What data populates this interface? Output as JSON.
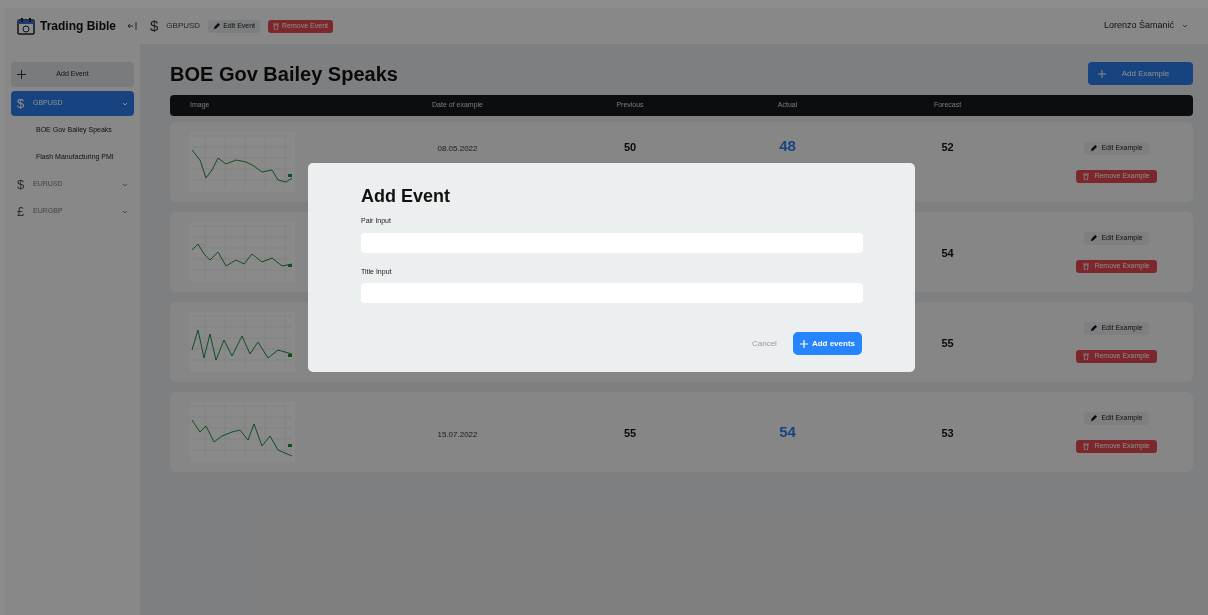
{
  "header": {
    "app_name": "Trading Bible",
    "pair_symbol": "$",
    "pair": "GBPUSD",
    "edit_button": "Edit Event",
    "remove_button": "Remove Event",
    "user": "Lorenzo Šamanić"
  },
  "sidebar": {
    "add_button": "Add Event",
    "groups": [
      {
        "symbol": "$",
        "label": "GBPUSD",
        "selected": true,
        "children": [
          {
            "label": "BOE Gov Bailey Speaks"
          },
          {
            "label": "Flash Manufacturing PMI"
          }
        ]
      },
      {
        "symbol": "$",
        "label": "EURUSD",
        "selected": false
      },
      {
        "symbol": "£",
        "label": "EURGBP",
        "selected": false
      }
    ]
  },
  "main": {
    "title": "BOE Gov Bailey Speaks",
    "add_button": "Add Example",
    "table": {
      "columns": [
        "Image",
        "Date of example",
        "Previous",
        "Actual",
        "Forecast"
      ],
      "rows": [
        {
          "date": "08.05.2022",
          "previous": "50",
          "actual": "48",
          "forecast": "52",
          "edit": "Edit Example",
          "remove": "Remove Example"
        },
        {
          "forecast": "54",
          "edit": "Edit Example",
          "remove": "Remove Example"
        },
        {
          "forecast": "55",
          "edit": "Edit Example",
          "remove": "Remove Example"
        },
        {
          "date": "15.07.2022",
          "previous": "55",
          "actual": "54",
          "forecast": "53",
          "edit": "Edit Example",
          "remove": "Remove Example"
        }
      ]
    }
  },
  "dialog": {
    "title": "Add Event",
    "fields": [
      {
        "label": "Pair Input"
      },
      {
        "label": "Title Input"
      }
    ],
    "cancel": "Cancel",
    "submit": "Add events"
  }
}
